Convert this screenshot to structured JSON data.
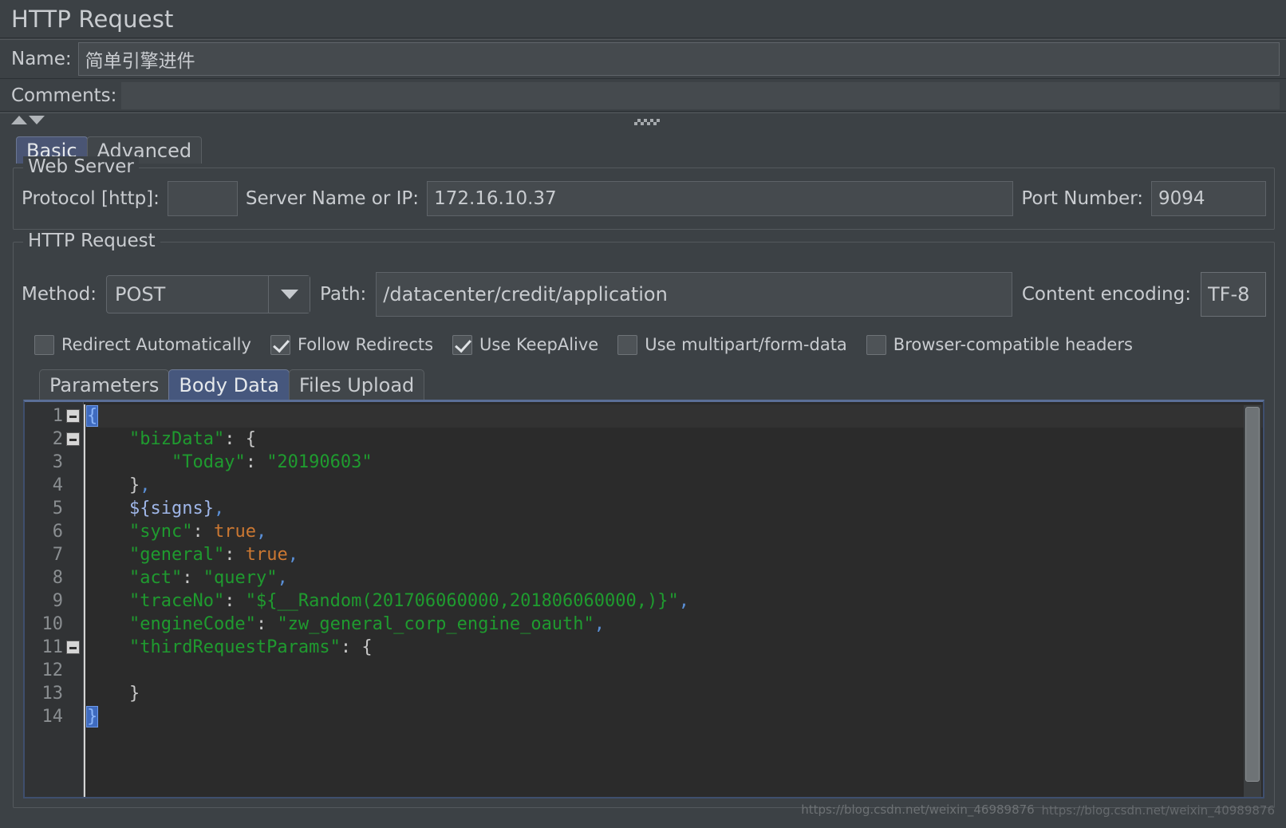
{
  "window": {
    "title": "HTTP Request"
  },
  "header": {
    "name_label": "Name:",
    "name_value": "简单引擎进件",
    "comments_label": "Comments:",
    "comments_value": ""
  },
  "top_tabs": [
    {
      "label": "Basic",
      "active": true
    },
    {
      "label": "Advanced",
      "active": false
    }
  ],
  "web_server": {
    "group_title": "Web Server",
    "protocol_label": "Protocol [http]:",
    "protocol_value": "",
    "server_label": "Server Name or IP:",
    "server_value": "172.16.10.37",
    "port_label": "Port Number:",
    "port_value": "9094"
  },
  "http_request": {
    "group_title": "HTTP Request",
    "method_label": "Method:",
    "method_value": "POST",
    "path_label": "Path:",
    "path_value": "/datacenter/credit/application",
    "encoding_label": "Content encoding:",
    "encoding_value": "TF-8"
  },
  "checkboxes": [
    {
      "label": "Redirect Automatically",
      "checked": false
    },
    {
      "label": "Follow Redirects",
      "checked": true
    },
    {
      "label": "Use KeepAlive",
      "checked": true
    },
    {
      "label": "Use multipart/form-data",
      "checked": false
    },
    {
      "label": "Browser-compatible headers",
      "checked": false
    }
  ],
  "inner_tabs": [
    {
      "label": "Parameters",
      "active": false
    },
    {
      "label": "Body Data",
      "active": true
    },
    {
      "label": "Files Upload",
      "active": false
    }
  ],
  "editor": {
    "lines": [
      {
        "num": "1",
        "fold": true,
        "current": true,
        "tokens": [
          {
            "t": "{",
            "c": "brace-hl"
          }
        ]
      },
      {
        "num": "2",
        "fold": true,
        "current": false,
        "tokens": [
          {
            "t": "    ",
            "c": "tok-punct"
          },
          {
            "t": "\"bizData\"",
            "c": "tok-key"
          },
          {
            "t": ": {",
            "c": "tok-punct"
          }
        ]
      },
      {
        "num": "3",
        "fold": false,
        "current": false,
        "tokens": [
          {
            "t": "        ",
            "c": "tok-punct"
          },
          {
            "t": "\"Today\"",
            "c": "tok-key"
          },
          {
            "t": ": ",
            "c": "tok-punct"
          },
          {
            "t": "\"20190603\"",
            "c": "tok-str"
          }
        ]
      },
      {
        "num": "4",
        "fold": false,
        "current": false,
        "tokens": [
          {
            "t": "    }",
            "c": "tok-punct"
          },
          {
            "t": ",",
            "c": "tok-comma"
          }
        ]
      },
      {
        "num": "5",
        "fold": false,
        "current": false,
        "tokens": [
          {
            "t": "    ",
            "c": "tok-punct"
          },
          {
            "t": "${signs}",
            "c": "tok-var"
          },
          {
            "t": ",",
            "c": "tok-comma"
          }
        ]
      },
      {
        "num": "6",
        "fold": false,
        "current": false,
        "tokens": [
          {
            "t": "    ",
            "c": "tok-punct"
          },
          {
            "t": "\"sync\"",
            "c": "tok-key"
          },
          {
            "t": ": ",
            "c": "tok-punct"
          },
          {
            "t": "true",
            "c": "tok-bool"
          },
          {
            "t": ",",
            "c": "tok-comma"
          }
        ]
      },
      {
        "num": "7",
        "fold": false,
        "current": false,
        "tokens": [
          {
            "t": "    ",
            "c": "tok-punct"
          },
          {
            "t": "\"general\"",
            "c": "tok-key"
          },
          {
            "t": ": ",
            "c": "tok-punct"
          },
          {
            "t": "true",
            "c": "tok-bool"
          },
          {
            "t": ",",
            "c": "tok-comma"
          }
        ]
      },
      {
        "num": "8",
        "fold": false,
        "current": false,
        "tokens": [
          {
            "t": "    ",
            "c": "tok-punct"
          },
          {
            "t": "\"act\"",
            "c": "tok-key"
          },
          {
            "t": ": ",
            "c": "tok-punct"
          },
          {
            "t": "\"query\"",
            "c": "tok-str"
          },
          {
            "t": ",",
            "c": "tok-comma"
          }
        ]
      },
      {
        "num": "9",
        "fold": false,
        "current": false,
        "tokens": [
          {
            "t": "    ",
            "c": "tok-punct"
          },
          {
            "t": "\"traceNo\"",
            "c": "tok-key"
          },
          {
            "t": ": ",
            "c": "tok-punct"
          },
          {
            "t": "\"${__Random(201706060000,201806060000,)}\"",
            "c": "tok-str"
          },
          {
            "t": ",",
            "c": "tok-comma"
          }
        ]
      },
      {
        "num": "10",
        "fold": false,
        "current": false,
        "tokens": [
          {
            "t": "    ",
            "c": "tok-punct"
          },
          {
            "t": "\"engineCode\"",
            "c": "tok-key"
          },
          {
            "t": ": ",
            "c": "tok-punct"
          },
          {
            "t": "\"zw_general_corp_engine_oauth\"",
            "c": "tok-str"
          },
          {
            "t": ",",
            "c": "tok-comma"
          }
        ]
      },
      {
        "num": "11",
        "fold": true,
        "current": false,
        "tokens": [
          {
            "t": "    ",
            "c": "tok-punct"
          },
          {
            "t": "\"thirdRequestParams\"",
            "c": "tok-key"
          },
          {
            "t": ": {",
            "c": "tok-punct"
          }
        ]
      },
      {
        "num": "12",
        "fold": false,
        "current": false,
        "tokens": []
      },
      {
        "num": "13",
        "fold": false,
        "current": false,
        "tokens": [
          {
            "t": "    }",
            "c": "tok-punct"
          }
        ]
      },
      {
        "num": "14",
        "fold": false,
        "current": false,
        "tokens": [
          {
            "t": "}",
            "c": "brace-hl"
          }
        ]
      }
    ]
  },
  "watermark": {
    "text_a": "https://blog.csdn.net/weixin_46989876",
    "text_b": "https://blog.csdn.net/weixin_40989876"
  },
  "colors": {
    "window_bg": "#3c4145",
    "field_bg": "#454a4e",
    "text": "#c9ccd0",
    "tab_active": "#46577d",
    "editor_bg": "#2b2b2b",
    "gutter_bg": "#313335",
    "string_green": "#1f9b2f",
    "bool_orange": "#cc7832",
    "var_blue": "#9fb6e8",
    "brace_highlight": "#3f6bbf"
  }
}
